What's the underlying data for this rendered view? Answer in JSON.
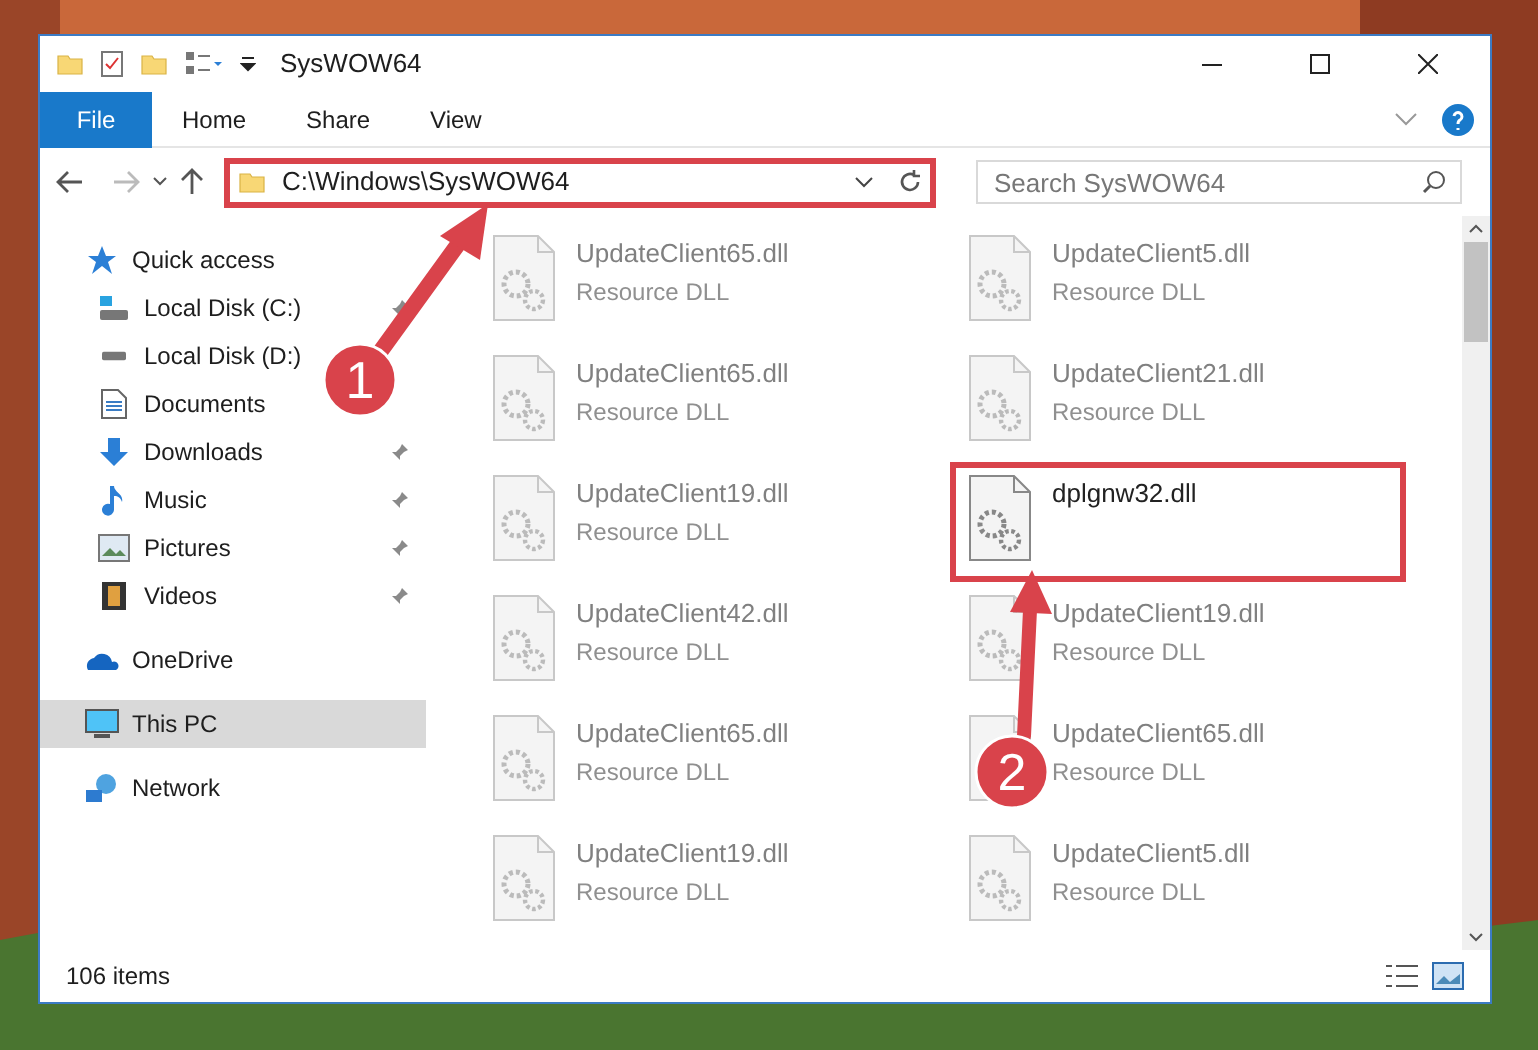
{
  "window": {
    "title": "SysWOW64"
  },
  "ribbon": {
    "file_tab": "File",
    "tabs": [
      "Home",
      "Share",
      "View"
    ]
  },
  "address": {
    "path": "C:\\Windows\\SysWOW64",
    "highlighted": true
  },
  "search": {
    "placeholder": "Search SysWOW64"
  },
  "sidebar": {
    "items": [
      {
        "label": "Quick access",
        "selected": false,
        "children": [
          {
            "label": "Local Disk (C:)",
            "pinned": true,
            "selected": false
          },
          {
            "label": "Local Disk (D:)",
            "pinned": false,
            "selected": false
          },
          {
            "label": "Documents",
            "pinned": false,
            "selected": false
          },
          {
            "label": "Downloads",
            "pinned": true,
            "selected": false
          },
          {
            "label": "Music",
            "pinned": true,
            "selected": false
          },
          {
            "label": "Pictures",
            "pinned": true,
            "selected": false
          },
          {
            "label": "Videos",
            "pinned": true,
            "selected": false
          }
        ]
      },
      {
        "label": "OneDrive",
        "selected": false
      },
      {
        "label": "This PC",
        "selected": true
      },
      {
        "label": "Network",
        "selected": false
      }
    ]
  },
  "files": [
    {
      "name": "UpdateClient65.dll",
      "type": "Resource DLL",
      "highlighted": false
    },
    {
      "name": "UpdateClient5.dll",
      "type": "Resource DLL",
      "highlighted": false
    },
    {
      "name": "UpdateClient65.dll",
      "type": "Resource DLL",
      "highlighted": false
    },
    {
      "name": "UpdateClient21.dll",
      "type": "Resource DLL",
      "highlighted": false
    },
    {
      "name": "UpdateClient19.dll",
      "type": "Resource DLL",
      "highlighted": false
    },
    {
      "name": "dplgnw32.dll",
      "highlighted": true
    },
    {
      "name": "UpdateClient42.dll",
      "type": "Resource DLL",
      "highlighted": false
    },
    {
      "name": "UpdateClient19.dll",
      "type": "Resource DLL",
      "highlighted": false
    },
    {
      "name": "UpdateClient65.dll",
      "type": "Resource DLL",
      "highlighted": false
    },
    {
      "name": "UpdateClient65.dll",
      "type": "Resource DLL",
      "highlighted": false
    },
    {
      "name": "UpdateClient19.dll",
      "type": "Resource DLL",
      "highlighted": false
    },
    {
      "name": "UpdateClient5.dll",
      "type": "Resource DLL",
      "highlighted": false
    }
  ],
  "annotations": [
    {
      "label": "1"
    },
    {
      "label": "2"
    }
  ],
  "status_bar": {
    "count": "106 items"
  }
}
